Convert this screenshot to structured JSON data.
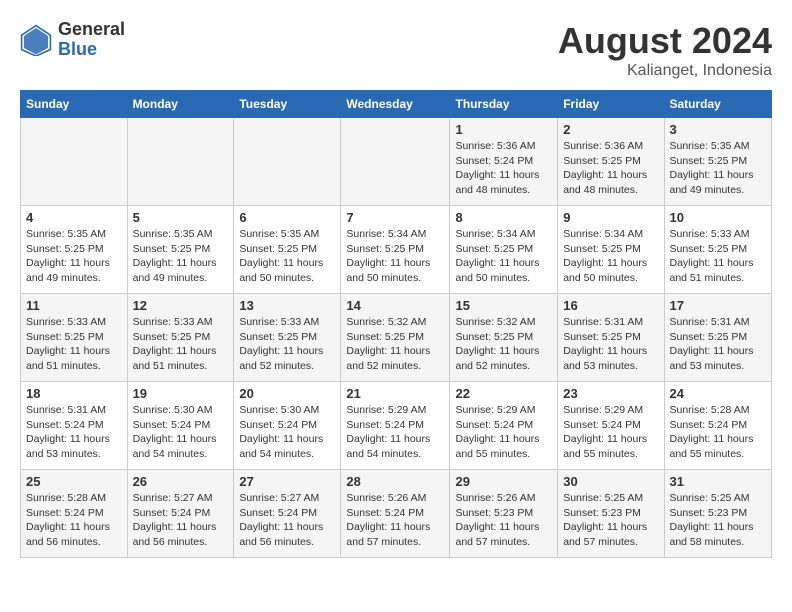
{
  "header": {
    "logo_general": "General",
    "logo_blue": "Blue",
    "month_year": "August 2024",
    "location": "Kalianget, Indonesia"
  },
  "days_of_week": [
    "Sunday",
    "Monday",
    "Tuesday",
    "Wednesday",
    "Thursday",
    "Friday",
    "Saturday"
  ],
  "weeks": [
    [
      {
        "day": "",
        "info": ""
      },
      {
        "day": "",
        "info": ""
      },
      {
        "day": "",
        "info": ""
      },
      {
        "day": "",
        "info": ""
      },
      {
        "day": "1",
        "info": "Sunrise: 5:36 AM\nSunset: 5:24 PM\nDaylight: 11 hours\nand 48 minutes."
      },
      {
        "day": "2",
        "info": "Sunrise: 5:36 AM\nSunset: 5:25 PM\nDaylight: 11 hours\nand 48 minutes."
      },
      {
        "day": "3",
        "info": "Sunrise: 5:35 AM\nSunset: 5:25 PM\nDaylight: 11 hours\nand 49 minutes."
      }
    ],
    [
      {
        "day": "4",
        "info": "Sunrise: 5:35 AM\nSunset: 5:25 PM\nDaylight: 11 hours\nand 49 minutes."
      },
      {
        "day": "5",
        "info": "Sunrise: 5:35 AM\nSunset: 5:25 PM\nDaylight: 11 hours\nand 49 minutes."
      },
      {
        "day": "6",
        "info": "Sunrise: 5:35 AM\nSunset: 5:25 PM\nDaylight: 11 hours\nand 50 minutes."
      },
      {
        "day": "7",
        "info": "Sunrise: 5:34 AM\nSunset: 5:25 PM\nDaylight: 11 hours\nand 50 minutes."
      },
      {
        "day": "8",
        "info": "Sunrise: 5:34 AM\nSunset: 5:25 PM\nDaylight: 11 hours\nand 50 minutes."
      },
      {
        "day": "9",
        "info": "Sunrise: 5:34 AM\nSunset: 5:25 PM\nDaylight: 11 hours\nand 50 minutes."
      },
      {
        "day": "10",
        "info": "Sunrise: 5:33 AM\nSunset: 5:25 PM\nDaylight: 11 hours\nand 51 minutes."
      }
    ],
    [
      {
        "day": "11",
        "info": "Sunrise: 5:33 AM\nSunset: 5:25 PM\nDaylight: 11 hours\nand 51 minutes."
      },
      {
        "day": "12",
        "info": "Sunrise: 5:33 AM\nSunset: 5:25 PM\nDaylight: 11 hours\nand 51 minutes."
      },
      {
        "day": "13",
        "info": "Sunrise: 5:33 AM\nSunset: 5:25 PM\nDaylight: 11 hours\nand 52 minutes."
      },
      {
        "day": "14",
        "info": "Sunrise: 5:32 AM\nSunset: 5:25 PM\nDaylight: 11 hours\nand 52 minutes."
      },
      {
        "day": "15",
        "info": "Sunrise: 5:32 AM\nSunset: 5:25 PM\nDaylight: 11 hours\nand 52 minutes."
      },
      {
        "day": "16",
        "info": "Sunrise: 5:31 AM\nSunset: 5:25 PM\nDaylight: 11 hours\nand 53 minutes."
      },
      {
        "day": "17",
        "info": "Sunrise: 5:31 AM\nSunset: 5:25 PM\nDaylight: 11 hours\nand 53 minutes."
      }
    ],
    [
      {
        "day": "18",
        "info": "Sunrise: 5:31 AM\nSunset: 5:24 PM\nDaylight: 11 hours\nand 53 minutes."
      },
      {
        "day": "19",
        "info": "Sunrise: 5:30 AM\nSunset: 5:24 PM\nDaylight: 11 hours\nand 54 minutes."
      },
      {
        "day": "20",
        "info": "Sunrise: 5:30 AM\nSunset: 5:24 PM\nDaylight: 11 hours\nand 54 minutes."
      },
      {
        "day": "21",
        "info": "Sunrise: 5:29 AM\nSunset: 5:24 PM\nDaylight: 11 hours\nand 54 minutes."
      },
      {
        "day": "22",
        "info": "Sunrise: 5:29 AM\nSunset: 5:24 PM\nDaylight: 11 hours\nand 55 minutes."
      },
      {
        "day": "23",
        "info": "Sunrise: 5:29 AM\nSunset: 5:24 PM\nDaylight: 11 hours\nand 55 minutes."
      },
      {
        "day": "24",
        "info": "Sunrise: 5:28 AM\nSunset: 5:24 PM\nDaylight: 11 hours\nand 55 minutes."
      }
    ],
    [
      {
        "day": "25",
        "info": "Sunrise: 5:28 AM\nSunset: 5:24 PM\nDaylight: 11 hours\nand 56 minutes."
      },
      {
        "day": "26",
        "info": "Sunrise: 5:27 AM\nSunset: 5:24 PM\nDaylight: 11 hours\nand 56 minutes."
      },
      {
        "day": "27",
        "info": "Sunrise: 5:27 AM\nSunset: 5:24 PM\nDaylight: 11 hours\nand 56 minutes."
      },
      {
        "day": "28",
        "info": "Sunrise: 5:26 AM\nSunset: 5:24 PM\nDaylight: 11 hours\nand 57 minutes."
      },
      {
        "day": "29",
        "info": "Sunrise: 5:26 AM\nSunset: 5:23 PM\nDaylight: 11 hours\nand 57 minutes."
      },
      {
        "day": "30",
        "info": "Sunrise: 5:25 AM\nSunset: 5:23 PM\nDaylight: 11 hours\nand 57 minutes."
      },
      {
        "day": "31",
        "info": "Sunrise: 5:25 AM\nSunset: 5:23 PM\nDaylight: 11 hours\nand 58 minutes."
      }
    ]
  ]
}
